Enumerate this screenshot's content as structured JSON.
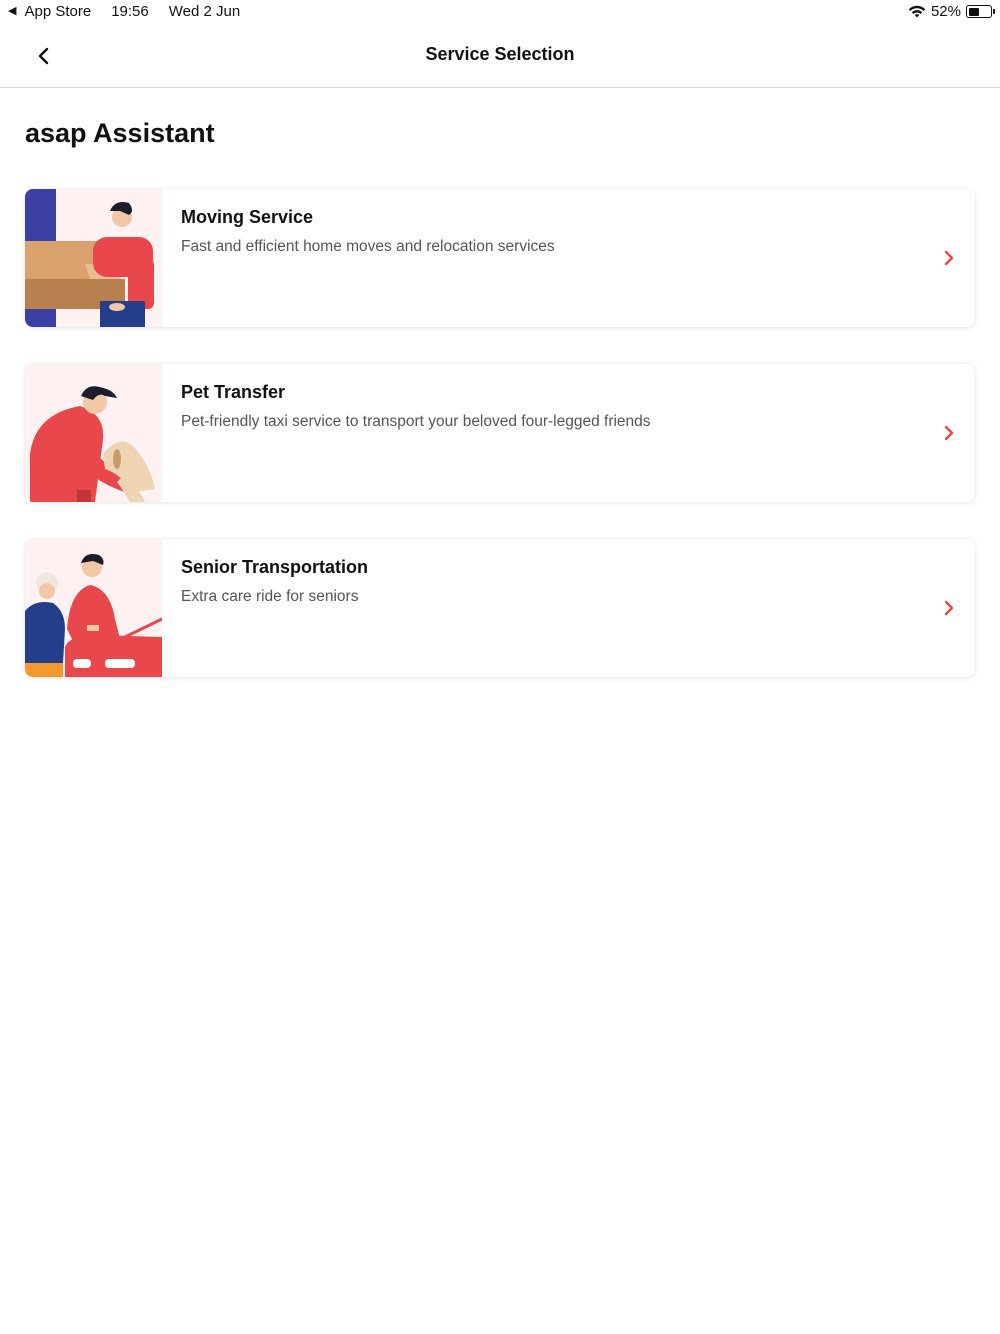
{
  "status_bar": {
    "back_app": "App Store",
    "time": "19:56",
    "date": "Wed 2 Jun",
    "battery": "52%",
    "battery_level": 0.52
  },
  "nav": {
    "title": "Service Selection",
    "back_icon": "chevron-left-icon"
  },
  "heading": "asap Assistant",
  "accent_color": "#e8474c",
  "services": [
    {
      "title": "Moving Service",
      "description": "Fast and efficient home moves and relocation services",
      "icon": "chevron-right-icon"
    },
    {
      "title": "Pet Transfer",
      "description": "Pet-friendly taxi service to transport your beloved four-legged friends",
      "icon": "chevron-right-icon"
    },
    {
      "title": "Senior Transportation",
      "description": "Extra care ride for seniors",
      "icon": "chevron-right-icon"
    }
  ]
}
